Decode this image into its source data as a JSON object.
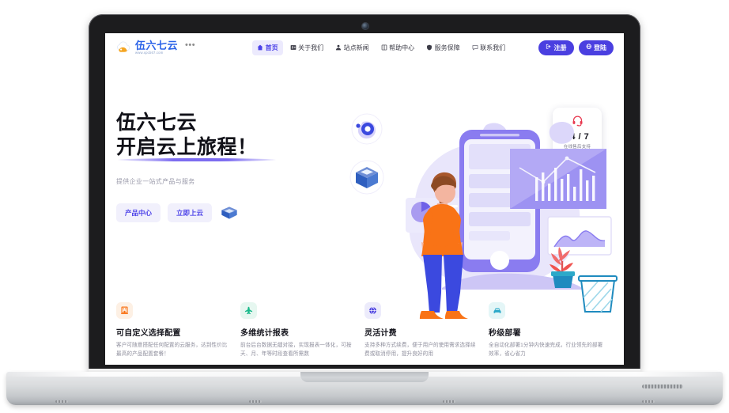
{
  "device": {
    "name": "laptop-mockup"
  },
  "site": {
    "brand": {
      "name": "伍六七云",
      "url": "www.xpcb67.com",
      "logo_icon": "cloud-icon",
      "menu_dots": "•••"
    },
    "nav": {
      "items": [
        {
          "label": "首页",
          "icon": "home-icon",
          "active": true
        },
        {
          "label": "关于我们",
          "icon": "info-card-icon",
          "active": false
        },
        {
          "label": "站点新闻",
          "icon": "user-news-icon",
          "active": false
        },
        {
          "label": "帮助中心",
          "icon": "book-icon",
          "active": false
        },
        {
          "label": "服务保障",
          "icon": "shield-icon",
          "active": false
        },
        {
          "label": "联系我们",
          "icon": "chat-icon",
          "active": false
        }
      ]
    },
    "auth": {
      "register_label": "注册",
      "register_icon": "login-arrow-icon",
      "login_label": "登陆",
      "login_icon": "globe-icon",
      "accent": "#4a3fe0"
    },
    "hero": {
      "title_line1": "伍六七云",
      "title_line2": "开启云上旅程！",
      "underline_color": "#7c6cf0",
      "subtitle": "提供企业一站式产品与服务",
      "primary_button": "产品中心",
      "secondary_button": "立即上云",
      "decoration_icon": "3d-box-icon"
    },
    "support_widget": {
      "icon": "headset-icon",
      "icon_color": "#e8384f",
      "value": "24 / 7",
      "label": "在线售后支持"
    },
    "illustration": {
      "name": "cloud-dashboard-illustration",
      "elements": [
        "person",
        "smartphone",
        "bar-chart-card",
        "area-chart-card",
        "pie-chart-card",
        "plant",
        "trash-bin",
        "shield-badge",
        "cube-badge"
      ],
      "palette": {
        "purple": "#7b6ef0",
        "light_purple": "#b3a9f5",
        "orange": "#f97316",
        "blue": "#3b49df",
        "teal": "#2ca9c9"
      }
    },
    "features": [
      {
        "icon": "building-icon",
        "icon_color": "#f97316",
        "icon_bg": "#fdf0e4",
        "title": "可自定义选择配置",
        "desc": "客户可随意搭配任何配置的云服务，达到性价比最高的产品配置套餐！"
      },
      {
        "icon": "plane-icon",
        "icon_color": "#18b98a",
        "icon_bg": "#e6f7f0",
        "title": "多维统计报表",
        "desc": "前台后台数据无缝对接，实现报表一体化，可按天、月、年等时段查看所需数"
      },
      {
        "icon": "globe-icon",
        "icon_color": "#4a3fe0",
        "icon_bg": "#ecebfb",
        "title": "灵活计费",
        "desc": "支持多种方式续费，便于用户的使用需求选择续费或取消停用，提升良好的用"
      },
      {
        "icon": "car-icon",
        "icon_color": "#2ca9c9",
        "icon_bg": "#e4f6f7",
        "title": "秒级部署",
        "desc": "全自动化部署1分钟内快速完成，行业领先的部署效率，省心省力"
      }
    ]
  }
}
